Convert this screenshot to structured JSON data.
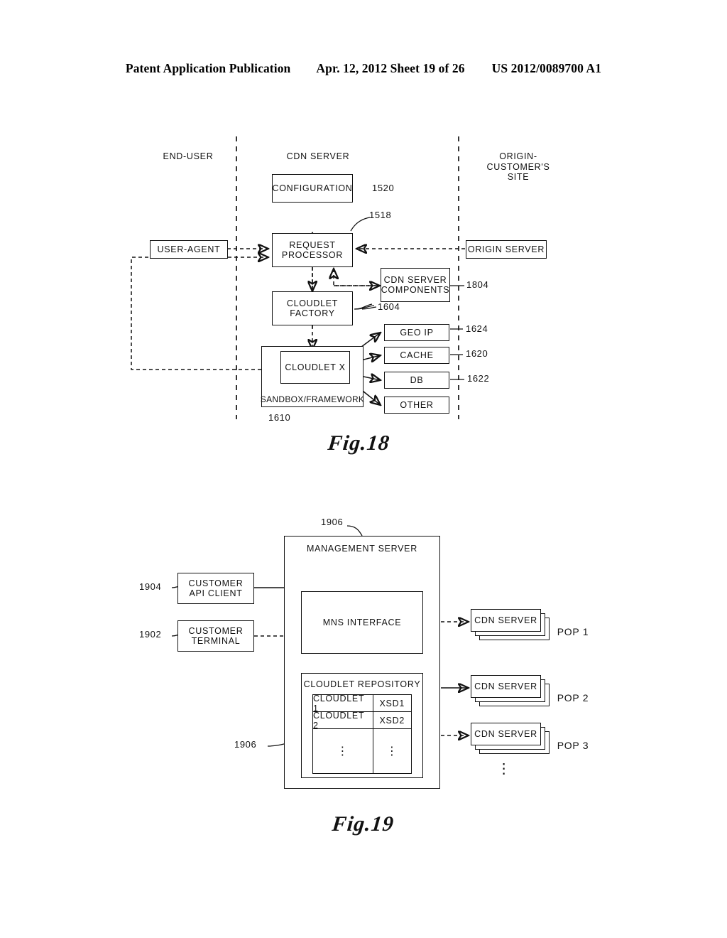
{
  "header": {
    "publication": "Patent Application Publication",
    "date_sheet": "Apr. 12, 2012  Sheet 19 of 26",
    "pub_number": "US 2012/0089700 A1"
  },
  "figure18": {
    "caption": "Fig.18",
    "columns": [
      {
        "label": "END-USER"
      },
      {
        "label": "CDN  SERVER"
      },
      {
        "label": "ORIGIN-\nCUSTOMER'S\nSITE"
      }
    ],
    "boxes": {
      "configuration": "CONFIGURATION",
      "request_processor": "REQUEST\nPROCESSOR",
      "user_agent": "USER-AGENT",
      "origin_server": "ORIGIN  SERVER",
      "cdn_server_components": "CDN  SERVER\nCOMPONENTS",
      "cloudlet_factory": "CLOUDLET\nFACTORY",
      "cloudlet_x": "CLOUDLET  X",
      "sandbox": "SANDBOX/FRAMEWORK",
      "geo_ip": "GEO IP",
      "cache": "CACHE",
      "db": "DB",
      "other": "OTHER"
    },
    "refs": {
      "configuration": "1520",
      "request_processor": "1518",
      "cdn_server_components": "1804",
      "cloudlet_factory": "1604",
      "sandbox": "1610",
      "geo_ip": "1624",
      "cache": "1620",
      "db": "1622"
    }
  },
  "figure19": {
    "caption": "Fig.19",
    "boxes": {
      "management_server": "MANAGEMENT  SERVER",
      "mns_interface": "MNS  INTERFACE",
      "cloudlet_repository": "CLOUDLET  REPOSITORY",
      "customer_api_client": "CUSTOMER\nAPI CLIENT",
      "customer_terminal": "CUSTOMER\nTERMINAL"
    },
    "refs": {
      "management_server": "1906",
      "customer_api_client": "1904",
      "customer_terminal": "1902",
      "cloudlet_repository": "1906"
    },
    "repository_rows": [
      {
        "name": "CLOUDLET 1",
        "schema": "XSD1"
      },
      {
        "name": "CLOUDLET 2",
        "schema": "XSD2"
      },
      {
        "name": "⋮",
        "schema": "⋮"
      }
    ],
    "pops": [
      {
        "server": "CDN  SERVER",
        "label": "POP 1"
      },
      {
        "server": "CDN  SERVER",
        "label": "POP 2"
      },
      {
        "server": "CDN  SERVER",
        "label": "POP 3"
      }
    ],
    "pop_continuation": "⋮"
  }
}
